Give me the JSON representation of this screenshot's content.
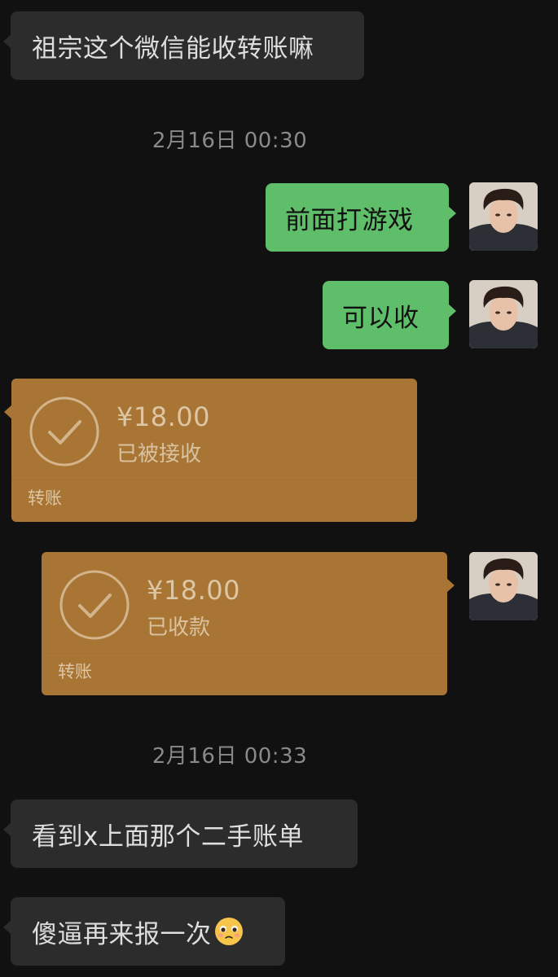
{
  "messages": {
    "m1": {
      "text": "祖宗这个微信能收转账嘛"
    },
    "time1": "2月16日 00:30",
    "m2": {
      "text": "前面打游戏"
    },
    "m3": {
      "text": "可以收"
    },
    "transfer_in": {
      "amount": "¥18.00",
      "status": "已被接收",
      "label": "转账"
    },
    "transfer_out": {
      "amount": "¥18.00",
      "status": "已收款",
      "label": "转账"
    },
    "time2": "2月16日 00:33",
    "m4": {
      "text": "看到x上面那个二手账单"
    },
    "m5": {
      "text": "傻逼再来报一次",
      "emoji": "pleading-face-emoji"
    }
  },
  "colors": {
    "background": "#111111",
    "incoming_bubble": "#2c2c2c",
    "outgoing_bubble": "#5fbe6a",
    "transfer_card": "#a87535",
    "timestamp": "#8a8a8a"
  }
}
